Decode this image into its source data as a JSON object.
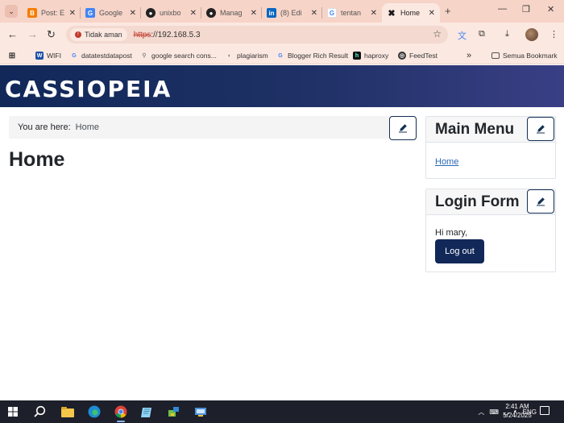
{
  "browser": {
    "tabs": [
      {
        "title": "Post: E",
        "icon": "blogger-icon",
        "color": "#f57d00"
      },
      {
        "title": "Google",
        "icon": "google-translate-icon",
        "color": "#4285f4"
      },
      {
        "title": "unixbo",
        "icon": "github-icon",
        "color": "#222222"
      },
      {
        "title": "Manag",
        "icon": "github-icon",
        "color": "#222222"
      },
      {
        "title": "(8) Edi",
        "icon": "linkedin-icon",
        "color": "#0a66c2"
      },
      {
        "title": "tentan",
        "icon": "google-icon",
        "color": "#4285f4"
      },
      {
        "title": "Home",
        "icon": "joomla-icon",
        "color": "#1a1a1a",
        "active": true
      }
    ],
    "security_label": "Tidak aman",
    "url_scheme": "https",
    "url_rest": "://192.168.5.3",
    "bookmarks": [
      "WIFI",
      "datatestdatapost",
      "google search cons...",
      "plagiarism",
      "Blogger Rich Result",
      "haproxy",
      "FeedTest"
    ],
    "all_bookmarks_label": "Semua Bookmark"
  },
  "site": {
    "brand": "CASSIOPEIA",
    "breadcrumb_prefix": "You are here:",
    "breadcrumb_current": "Home",
    "page_title": "Home",
    "main_menu": {
      "title": "Main Menu",
      "items": [
        "Home"
      ]
    },
    "login_form": {
      "title": "Login Form",
      "greeting": "Hi mary,",
      "logout_label": "Log out"
    },
    "colors": {
      "header_start": "#112859",
      "header_end": "#3a3f85",
      "button": "#112859",
      "link": "#2a69b8"
    }
  },
  "taskbar": {
    "language": "ENG",
    "time": "2:41 AM",
    "date": "5/24/2025"
  }
}
